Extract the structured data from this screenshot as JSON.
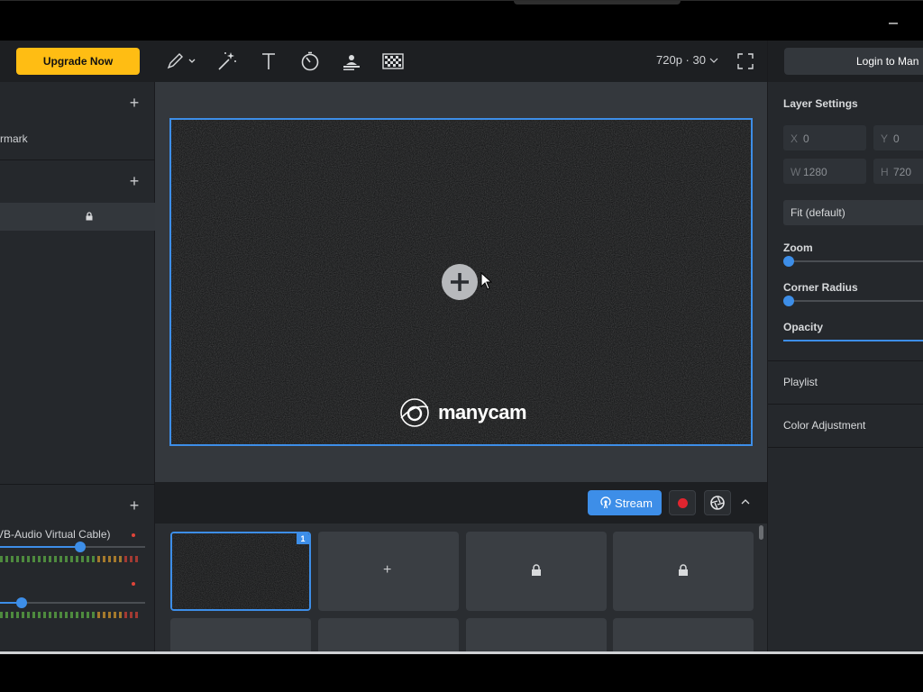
{
  "left_panel": {
    "upgrade_label": "Upgrade Now",
    "watermark_item": "rmark",
    "audio_device": "VB-Audio Virtual Cable)",
    "volume_1": 0.55,
    "volume_2": 0.15
  },
  "toolbar": {
    "icons": [
      "pencil-icon",
      "magic-wand-icon",
      "text-icon",
      "timer-icon",
      "lower-third-icon",
      "chroma-key-icon"
    ],
    "resolution": "720p · 30"
  },
  "stream_bar": {
    "stream_label": "Stream"
  },
  "presets": {
    "active_badge": "1"
  },
  "right_panel": {
    "login_label": "Login to Man",
    "layer_settings_title": "Layer Settings",
    "x_key": "X",
    "x_value": "0",
    "y_key": "Y",
    "y_value": "0",
    "w_key": "W",
    "w_value": "1280",
    "h_key": "H",
    "h_value": "720",
    "fit_mode": "Fit (default)",
    "zoom_label": "Zoom",
    "zoom_value": 0,
    "corner_radius_label": "Corner Radius",
    "corner_radius_value": 0,
    "opacity_label": "Opacity",
    "opacity_value": 1,
    "playlist_label": "Playlist",
    "color_adjustment_label": "Color Adjustment"
  },
  "preview": {
    "logo_text": "manycam"
  },
  "colors": {
    "accent": "#3d8ee8",
    "upgrade": "#ffbd13",
    "record": "#e0252f"
  }
}
